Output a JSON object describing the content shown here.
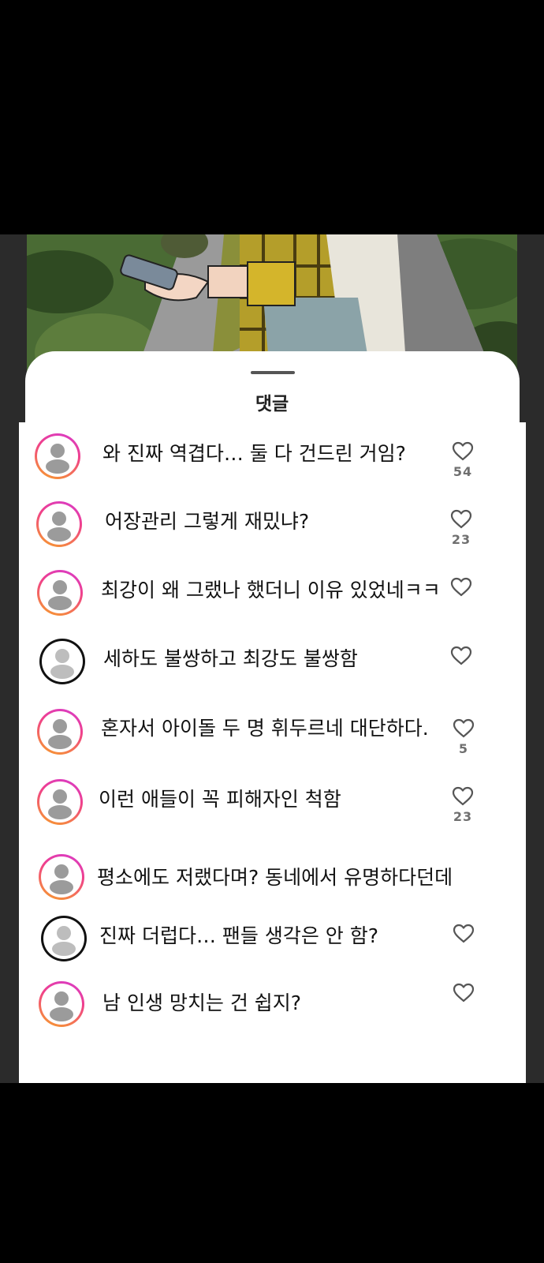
{
  "sheet": {
    "title": "댓글"
  },
  "comments": [
    {
      "text": "와 진짜 역겹다… 둘 다 건드린 거임?",
      "likes": "54",
      "avatar": "gradient"
    },
    {
      "text": "어장관리 그렇게 재밌냐?",
      "likes": "23",
      "avatar": "gradient"
    },
    {
      "text": "최강이 왜 그랬나 했더니 이유 있었네ㅋㅋ",
      "likes": "",
      "avatar": "gradient"
    },
    {
      "text": "세하도 불쌍하고 최강도 불쌍함",
      "likes": "",
      "avatar": "plain"
    },
    {
      "text": "혼자서 아이돌 두 명 휘두르네 대단하다.",
      "likes": "5",
      "avatar": "gradient"
    },
    {
      "text": "이런 애들이 꼭 피해자인 척함",
      "likes": "23",
      "avatar": "gradient"
    },
    {
      "text": "평소에도 저랬다며? 동네에서 유명하다던데",
      "likes": "",
      "avatar": "gradient"
    },
    {
      "text": "진짜 더럽다… 팬들 생각은 안 함?",
      "likes": "",
      "avatar": "plain"
    },
    {
      "text": "남 인생 망치는 건 쉽지?",
      "likes": "",
      "avatar": "gradient"
    }
  ]
}
